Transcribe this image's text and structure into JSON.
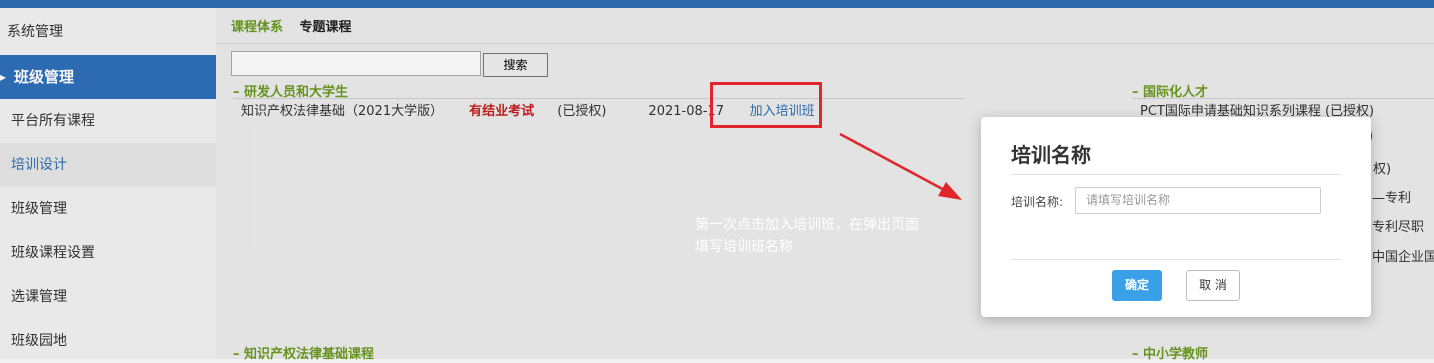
{
  "sidebar": {
    "top_item": "系统管理",
    "section_header": "班级管理",
    "items": [
      {
        "label": "平台所有课程"
      },
      {
        "label": "培训设计"
      },
      {
        "label": "班级管理"
      },
      {
        "label": "班级课程设置"
      },
      {
        "label": "选课管理"
      },
      {
        "label": "班级园地"
      }
    ]
  },
  "tabs": [
    "课程体系",
    "专题课程"
  ],
  "search": {
    "button": "搜索",
    "value": ""
  },
  "sections": {
    "left_top": "研发人员和大学生",
    "right_top": "国际化人才",
    "left_bottom": "知识产权法律基础课程",
    "right_bottom": "中小学教师",
    "prefix": "–"
  },
  "course": {
    "name": "知识产权法律基础（2021大学版）",
    "exam": "有结业考试",
    "status": "(已授权)",
    "date": "2021-08-17",
    "action": "加入培训班"
  },
  "right_courses": [
    "PCT国际申请基础知识系列课程   (已授权)",
    ")",
    "权)",
    "—专利",
    "专利尽职",
    "中国企业国"
  ],
  "annotation": {
    "line1": "第一次点击加入培训班，在弹出页面",
    "line2": "填写培训班名称"
  },
  "modal": {
    "title": "培训名称",
    "label": "培训名称:",
    "placeholder": "请填写培训名称",
    "ok": "确定",
    "cancel": "取 消"
  },
  "colors": {
    "brand_blue": "#2e6fba",
    "accent_green": "#6a9a1f",
    "exam_red": "#c21f1f",
    "highlight_red": "#e0262b",
    "ok_blue": "#3aa0e8"
  }
}
